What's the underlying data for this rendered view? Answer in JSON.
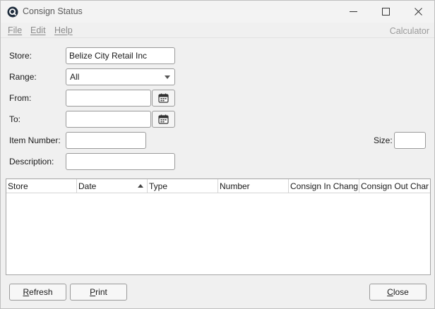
{
  "window": {
    "title": "Consign Status",
    "minimize_icon": "minimize-icon",
    "maximize_icon": "maximize-icon",
    "close_icon": "close-icon"
  },
  "menu": {
    "file": "File",
    "edit": "Edit",
    "help": "Help",
    "calculator": "Calculator"
  },
  "form": {
    "store_label": "Store:",
    "store_value": "Belize City Retail Inc",
    "range_label": "Range:",
    "range_value": "All",
    "from_label": "From:",
    "from_value": "",
    "to_label": "To:",
    "to_value": "",
    "item_number_label": "Item Number:",
    "item_number_value": "",
    "size_label": "Size:",
    "size_value": "",
    "description_label": "Description:",
    "description_value": "",
    "calendar_icon": "calendar-icon"
  },
  "grid": {
    "columns": [
      "Store",
      "Date",
      "Type",
      "Number",
      "Consign In Chang",
      "Consign Out Char"
    ],
    "sorted_column": "Date",
    "sort_direction": "ascending",
    "rows": []
  },
  "buttons": {
    "refresh_u": "R",
    "refresh_rest": "efresh",
    "print_u": "P",
    "print_rest": "rint",
    "close_u": "C",
    "close_rest": "lose"
  }
}
